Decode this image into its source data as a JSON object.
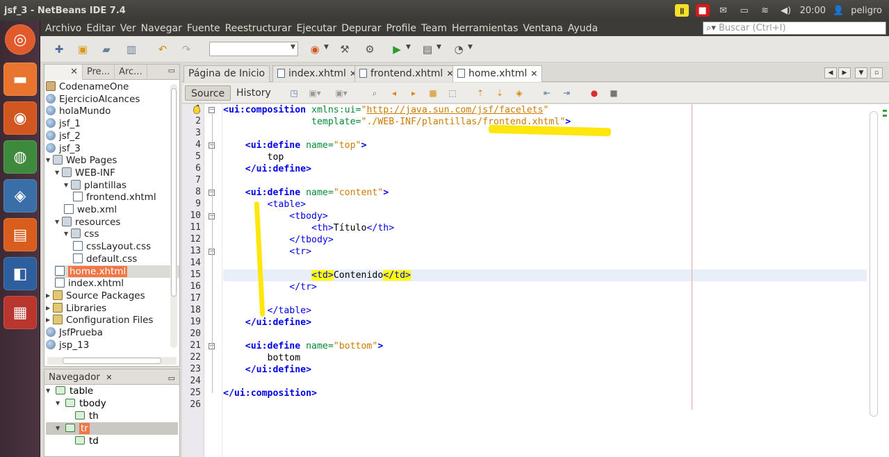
{
  "window_title": "jsf_3 - NetBeans IDE 7.4",
  "tray": {
    "time": "20:00",
    "user": "peligro"
  },
  "menu": [
    "Archivo",
    "Editar",
    "Ver",
    "Navegar",
    "Fuente",
    "Reestructurar",
    "Ejecutar",
    "Depurar",
    "Profile",
    "Team",
    "Herramientas",
    "Ventana",
    "Ayuda"
  ],
  "search": {
    "placeholder": "Buscar (Ctrl+I)"
  },
  "projects_panel": {
    "tabs": [
      "Pre...",
      "Arc..."
    ],
    "tree": [
      {
        "label": "CodenameOne",
        "depth": 0,
        "icon": "cup-icon",
        "arrow": ""
      },
      {
        "label": "EjercicioAlcances",
        "depth": 0,
        "icon": "globe-icon",
        "arrow": ""
      },
      {
        "label": "holaMundo",
        "depth": 0,
        "icon": "globe-icon",
        "arrow": ""
      },
      {
        "label": "jsf_1",
        "depth": 0,
        "icon": "globe-icon",
        "arrow": ""
      },
      {
        "label": "jsf_2",
        "depth": 0,
        "icon": "globe-icon",
        "arrow": ""
      },
      {
        "label": "jsf_3",
        "depth": 0,
        "icon": "globe-icon",
        "arrow": ""
      },
      {
        "label": "Web Pages",
        "depth": 0,
        "icon": "folder-icon",
        "arrow": "down"
      },
      {
        "label": "WEB-INF",
        "depth": 1,
        "icon": "folder-icon",
        "arrow": "down"
      },
      {
        "label": "plantillas",
        "depth": 2,
        "icon": "folder-icon",
        "arrow": "down"
      },
      {
        "label": "frontend.xhtml",
        "depth": 3,
        "icon": "file-icon",
        "arrow": ""
      },
      {
        "label": "web.xml",
        "depth": 2,
        "icon": "file-icon",
        "arrow": ""
      },
      {
        "label": "resources",
        "depth": 1,
        "icon": "folder-icon",
        "arrow": "down"
      },
      {
        "label": "css",
        "depth": 2,
        "icon": "folder-icon",
        "arrow": "down"
      },
      {
        "label": "cssLayout.css",
        "depth": 3,
        "icon": "file-icon",
        "arrow": ""
      },
      {
        "label": "default.css",
        "depth": 3,
        "icon": "file-icon",
        "arrow": ""
      },
      {
        "label": "home.xhtml",
        "depth": 1,
        "icon": "file-icon",
        "arrow": "",
        "selected": true
      },
      {
        "label": "index.xhtml",
        "depth": 1,
        "icon": "file-icon",
        "arrow": ""
      },
      {
        "label": "Source Packages",
        "depth": 0,
        "icon": "package-icon",
        "arrow": "right"
      },
      {
        "label": "Libraries",
        "depth": 0,
        "icon": "package-icon",
        "arrow": "right"
      },
      {
        "label": "Configuration Files",
        "depth": 0,
        "icon": "package-icon",
        "arrow": "right"
      },
      {
        "label": "JsfPrueba",
        "depth": 0,
        "icon": "globe-icon",
        "arrow": ""
      },
      {
        "label": "jsp_13",
        "depth": 0,
        "icon": "globe-icon",
        "arrow": ""
      }
    ]
  },
  "navigator": {
    "title": "Navegador",
    "items": [
      {
        "label": "table",
        "depth": 0,
        "arrow": "down"
      },
      {
        "label": "tbody",
        "depth": 1,
        "arrow": "down"
      },
      {
        "label": "th",
        "depth": 2,
        "arrow": ""
      },
      {
        "label": "tr",
        "depth": 1,
        "arrow": "down",
        "selected": true
      },
      {
        "label": "td",
        "depth": 2,
        "arrow": ""
      }
    ]
  },
  "editor_tabs": [
    {
      "label": "Página de Inicio",
      "icon": false,
      "active": false
    },
    {
      "label": "index.xhtml",
      "icon": true,
      "active": false
    },
    {
      "label": "frontend.xhtml",
      "icon": true,
      "active": false
    },
    {
      "label": "home.xhtml",
      "icon": true,
      "active": true
    }
  ],
  "view_buttons": {
    "source": "Source",
    "history": "History"
  },
  "code": {
    "current_line": 15,
    "lines": [
      [
        {
          "t": "<ui:composition",
          "c": "tgb"
        },
        {
          "t": " xmlns:ui=",
          "c": "at"
        },
        {
          "t": "\"",
          "c": "av"
        },
        {
          "t": "http://java.sun.com/jsf/facelets",
          "c": "lk"
        },
        {
          "t": "\"",
          "c": "av"
        }
      ],
      [
        {
          "t": "                template=",
          "c": "at"
        },
        {
          "t": "\"./WEB-INF/plantillas/frontend.xhtml\"",
          "c": "av"
        },
        {
          "t": ">",
          "c": "tgb"
        }
      ],
      [],
      [
        {
          "t": "    <ui:define",
          "c": "tgb"
        },
        {
          "t": " name=",
          "c": "at"
        },
        {
          "t": "\"top\"",
          "c": "av"
        },
        {
          "t": ">",
          "c": "tgb"
        }
      ],
      [
        {
          "t": "        top",
          "c": ""
        }
      ],
      [
        {
          "t": "    </ui:define>",
          "c": "tgb"
        }
      ],
      [],
      [
        {
          "t": "    <ui:define",
          "c": "tgb"
        },
        {
          "t": " name=",
          "c": "at"
        },
        {
          "t": "\"content\"",
          "c": "av"
        },
        {
          "t": ">",
          "c": "tgb"
        }
      ],
      [
        {
          "t": "        <table>",
          "c": "tg"
        }
      ],
      [
        {
          "t": "            <tbody>",
          "c": "tg"
        }
      ],
      [
        {
          "t": "                <th>",
          "c": "tg"
        },
        {
          "t": "Título",
          "c": ""
        },
        {
          "t": "</th>",
          "c": "tg"
        }
      ],
      [
        {
          "t": "            </tbody>",
          "c": "tg"
        }
      ],
      [
        {
          "t": "            <tr>",
          "c": "tg"
        }
      ],
      [],
      [
        {
          "t": "                ",
          "c": ""
        },
        {
          "t": "<td>",
          "c": "tg hl"
        },
        {
          "t": "Contenido",
          "c": ""
        },
        {
          "t": "</td>",
          "c": "tg hl"
        }
      ],
      [
        {
          "t": "            </tr>",
          "c": "tg"
        }
      ],
      [],
      [
        {
          "t": "        </table>",
          "c": "tg"
        }
      ],
      [
        {
          "t": "    </ui:define>",
          "c": "tgb"
        }
      ],
      [],
      [
        {
          "t": "    <ui:define",
          "c": "tgb"
        },
        {
          "t": " name=",
          "c": "at"
        },
        {
          "t": "\"bottom\"",
          "c": "av"
        },
        {
          "t": ">",
          "c": "tgb"
        }
      ],
      [
        {
          "t": "        bottom",
          "c": ""
        }
      ],
      [
        {
          "t": "    </ui:define>",
          "c": "tgb"
        }
      ],
      [],
      [
        {
          "t": "</ui:composition>",
          "c": "tgb"
        }
      ],
      []
    ]
  }
}
